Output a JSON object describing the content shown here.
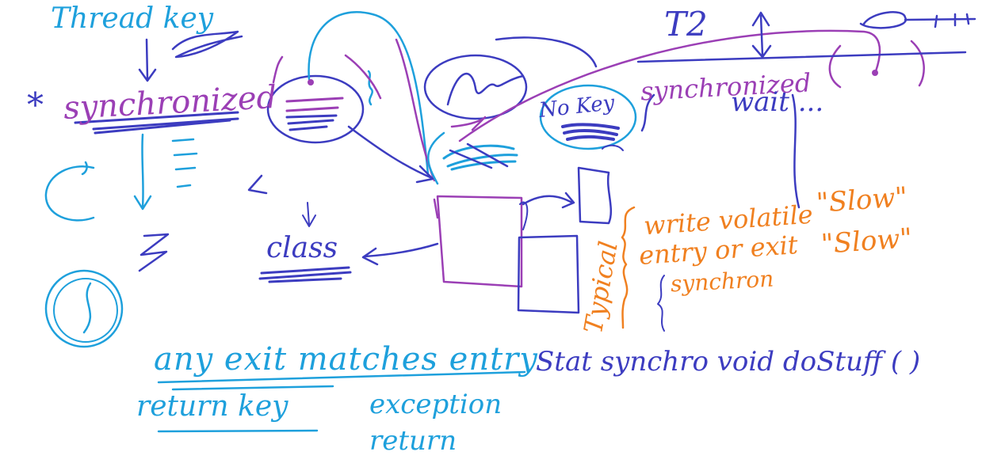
{
  "colors": {
    "cyan": "#1ea0dc",
    "blue": "#3c3cc0",
    "purple": "#9b3fb5",
    "orange": "#f08020"
  },
  "notes": {
    "thread_key": "Thread key",
    "synchronized_left": "synchronized",
    "class": "class",
    "asterisk": "*",
    "t2": "T2",
    "synchronized_right": "synchronized",
    "wait": "wait ...",
    "no_key": "No Key",
    "write_volatile": "write volatile",
    "entry_or_exit": "entry or exit",
    "synchron": "synchron",
    "slow_1": "\"Slow\"",
    "slow_2": "\"Slow\"",
    "typical": "Typical",
    "any_exit": "any exit matches entry",
    "return_key": "return key",
    "exception": "exception",
    "return": "return",
    "static_sync": "Stat   synchro  void  doStuff ( )"
  }
}
